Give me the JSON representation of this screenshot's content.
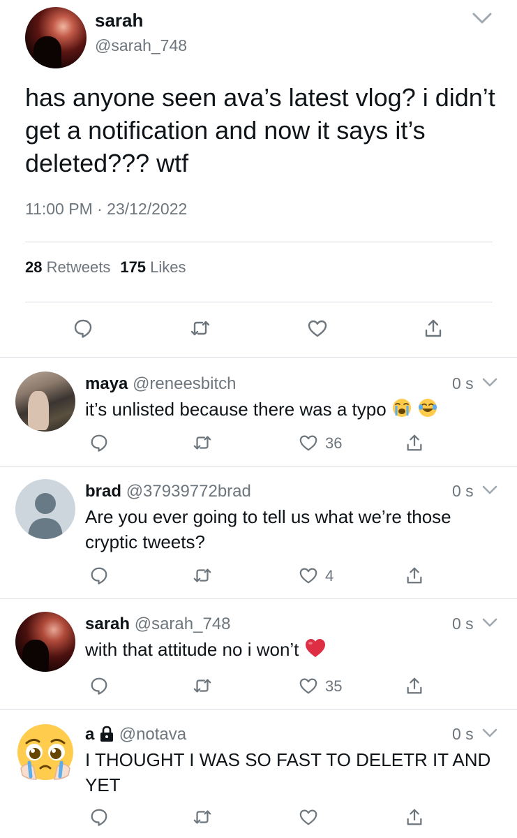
{
  "main_tweet": {
    "author_name": "sarah",
    "author_handle": "@sarah_748",
    "text": "has anyone seen ava’s latest vlog? i didn’t get a notification and now it says it’s deleted??? wtf",
    "timestamp": "11:00 PM · 23/12/2022",
    "retweets_count": "28",
    "retweets_label": "Retweets",
    "likes_count": "175",
    "likes_label": "Likes"
  },
  "replies": [
    {
      "name": "maya",
      "handle": "@reneesbitch",
      "time": "0 s",
      "text": "it’s unlisted because there was a typo",
      "emojis": [
        "loudly-crying-face",
        "face-with-tears-of-joy"
      ],
      "like_count": "36"
    },
    {
      "name": "brad",
      "handle": "@37939772brad",
      "time": "0 s",
      "text": "Are you ever going to tell us what we’re those cryptic tweets?",
      "like_count": "4"
    },
    {
      "name": "sarah",
      "handle": "@sarah_748",
      "time": "0 s",
      "text": "with that attitude no i won’t",
      "emojis": [
        "red-heart"
      ],
      "like_count": "35"
    },
    {
      "name": "a",
      "handle": "@notava",
      "protected": true,
      "time": "0 s",
      "text": "I THOUGHT I WAS SO FAST TO DELETR IT AND YET",
      "like_count": ""
    }
  ],
  "icons": {
    "reply": "reply-icon",
    "retweet": "retweet-icon",
    "like": "heart-icon",
    "share": "share-icon",
    "more": "chevron-down-icon",
    "lock": "lock-icon"
  },
  "colors": {
    "text": "#0f1419",
    "secondary": "#6e767d",
    "divider": "#d9dde1",
    "heart_red": "#e0245e"
  }
}
